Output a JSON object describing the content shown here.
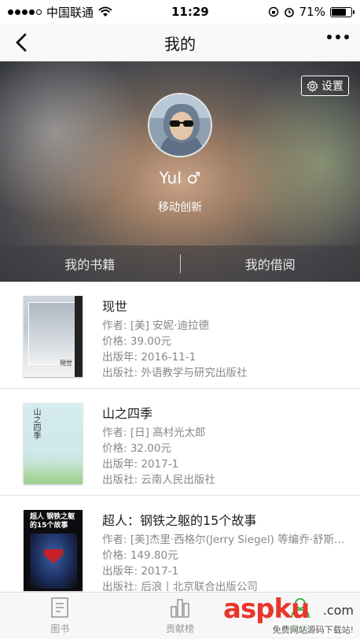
{
  "status": {
    "carrier": "中国联通",
    "time": "11:29",
    "battery": "71%"
  },
  "nav": {
    "title": "我的"
  },
  "profile": {
    "settings_label": "设置",
    "username": "YuI ♂",
    "org": "移动创新",
    "tabs": [
      "我的书籍",
      "我的借阅"
    ]
  },
  "books": [
    {
      "title": "现世",
      "author": "作者: [美] 安妮·迪拉德",
      "price": "价格: 39.00元",
      "date": "出版年: 2016-11-1",
      "publisher": "出版社: 外语教学与研究出版社",
      "cover_text": "現世"
    },
    {
      "title": "山之四季",
      "author": "作者: [日] 高村光太郎",
      "price": "价格: 32.00元",
      "date": "出版年: 2017-1",
      "publisher": "出版社: 云南人民出版社",
      "cover_text": "山之四季"
    },
    {
      "title": "超人：钢铁之躯的15个故事",
      "author": "作者: [美]杰里·西格尔(Jerry Siegel) 等编乔·舒斯特...",
      "price": "价格: 149.80元",
      "date": "出版年: 2017-1",
      "publisher": "出版社: 后浪丨北京联合出版公司",
      "cover_text": "超人 钢铁之躯的15个故事"
    }
  ],
  "tabbar": {
    "items": [
      "图书",
      "贡献榜",
      "我的"
    ]
  },
  "watermark": {
    "logo": "aspku",
    "com": ".com",
    "text": "免费网站源码下载站!"
  },
  "colors": {
    "active_tab": "#2fae4a",
    "watermark": "#e8362b"
  }
}
